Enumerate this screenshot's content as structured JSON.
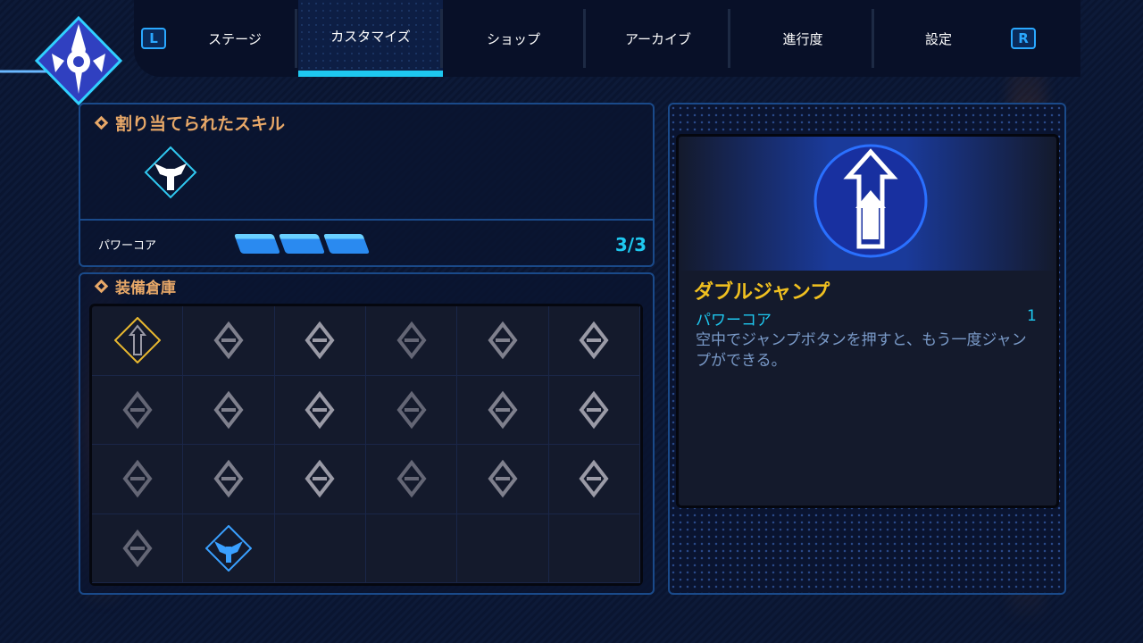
{
  "nav": {
    "left_button": "L",
    "right_button": "R",
    "tabs": [
      {
        "label": "ステージ"
      },
      {
        "label": "カスタマイズ",
        "active": true
      },
      {
        "label": "ショップ"
      },
      {
        "label": "アーカイブ"
      },
      {
        "label": "進行度"
      },
      {
        "label": "設定"
      }
    ]
  },
  "assigned": {
    "title": "割り当てられたスキル",
    "power_core_label": "パワーコア",
    "power_core_value": "3/3",
    "power_core_filled": 3,
    "power_core_total": 3
  },
  "inventory": {
    "title": "装備倉庫",
    "items": [
      {
        "icon": "double-jump-icon",
        "selected": true
      },
      {
        "icon": "dash-icon"
      },
      {
        "icon": "star-diamond-icon"
      },
      {
        "icon": "warrior-icon"
      },
      {
        "icon": "star-x2-icon"
      },
      {
        "icon": "crossed-swords-icon"
      },
      {
        "icon": "sword-icon"
      },
      {
        "icon": "lightning-slash-icon"
      },
      {
        "icon": "air-dash-icon"
      },
      {
        "icon": "slash-x2-icon"
      },
      {
        "icon": "crosshair-icon"
      },
      {
        "icon": "spiked-crosshair-icon"
      },
      {
        "icon": "speed-icon"
      },
      {
        "icon": "fast-speed-icon"
      },
      {
        "icon": "cross-icon"
      },
      {
        "icon": "winged-cross-icon"
      },
      {
        "icon": "crescent-slash-icon"
      },
      {
        "icon": "triple-crescent-icon"
      },
      {
        "icon": "figure-icon"
      },
      {
        "icon": "winged-shield-icon",
        "equipped": true
      }
    ]
  },
  "detail": {
    "name": "ダブルジャンプ",
    "cost_label": "パワーコア",
    "cost_value": "1",
    "description": "空中でジャンプボタンを押すと、もう一度ジャンプができる。"
  },
  "colors": {
    "accent": "#1ec8f0",
    "title": "#e8a868",
    "skill_name": "#f0c020",
    "selected": "#e8b830"
  }
}
